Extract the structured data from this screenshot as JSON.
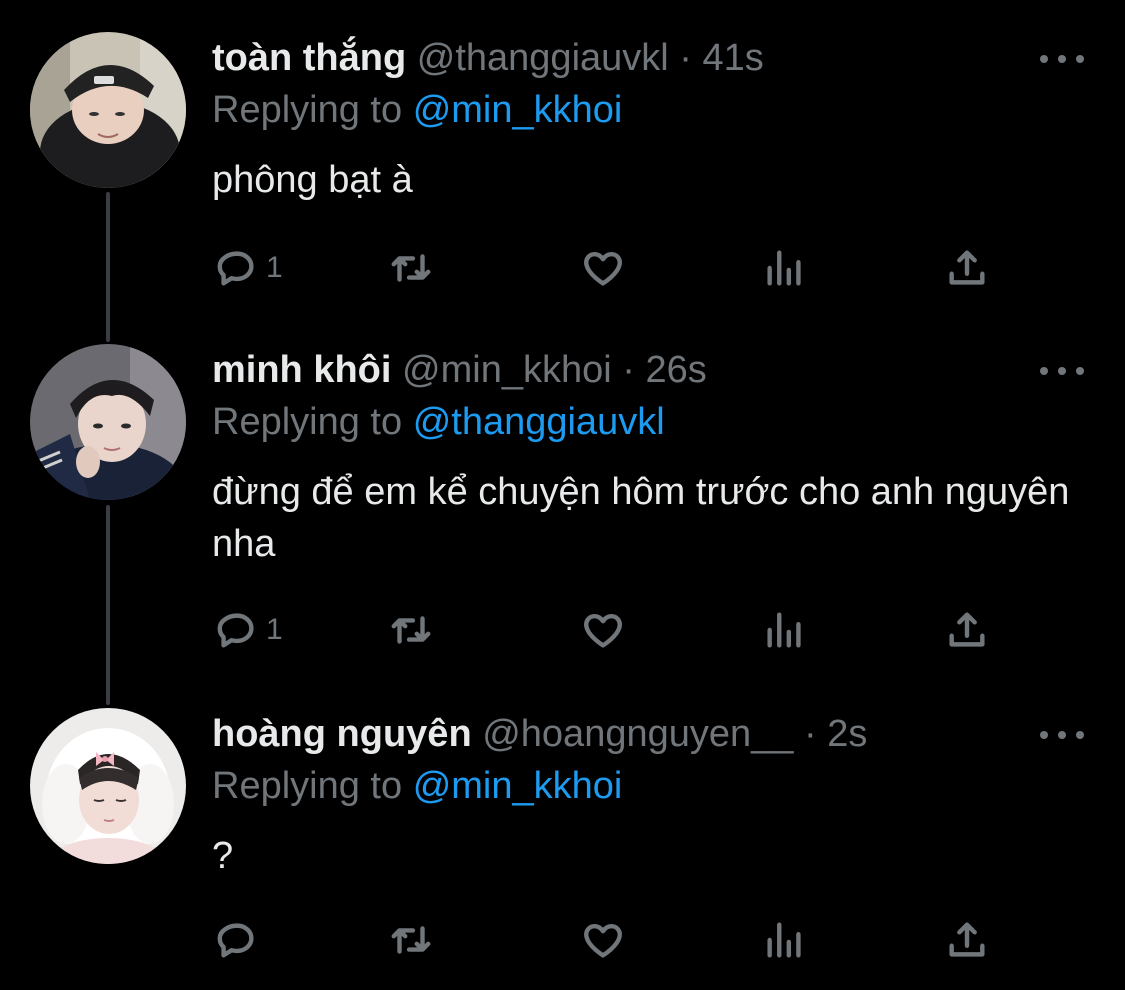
{
  "colors": {
    "background": "#000000",
    "text_primary": "#e7e9ea",
    "text_secondary": "#71767b",
    "mention": "#1d9bf0",
    "thread_line": "#3a3d41"
  },
  "tweets": [
    {
      "display_name": "toàn thắng",
      "handle": "@thanggiauvkl",
      "separator": "·",
      "time": "41s",
      "replying_prefix": "Replying to",
      "replying_to": "@min_kkhoi",
      "text": "phông bạt à",
      "reply_count": "1",
      "icons": [
        "more-icon",
        "reply-icon",
        "retweet-icon",
        "like-icon",
        "views-icon",
        "share-icon"
      ]
    },
    {
      "display_name": "minh khôi",
      "handle": "@min_kkhoi",
      "separator": "·",
      "time": "26s",
      "replying_prefix": "Replying to",
      "replying_to": "@thanggiauvkl",
      "text": "đừng để em kể chuyện hôm trước cho anh nguyên nha",
      "reply_count": "1",
      "icons": [
        "more-icon",
        "reply-icon",
        "retweet-icon",
        "like-icon",
        "views-icon",
        "share-icon"
      ]
    },
    {
      "display_name": "hoàng nguyên",
      "handle": "@hoangnguyen__",
      "separator": "·",
      "time": "2s",
      "replying_prefix": "Replying to",
      "replying_to": "@min_kkhoi",
      "text": "?",
      "reply_count": "",
      "icons": [
        "more-icon",
        "reply-icon",
        "retweet-icon",
        "like-icon",
        "views-icon",
        "share-icon"
      ]
    }
  ]
}
